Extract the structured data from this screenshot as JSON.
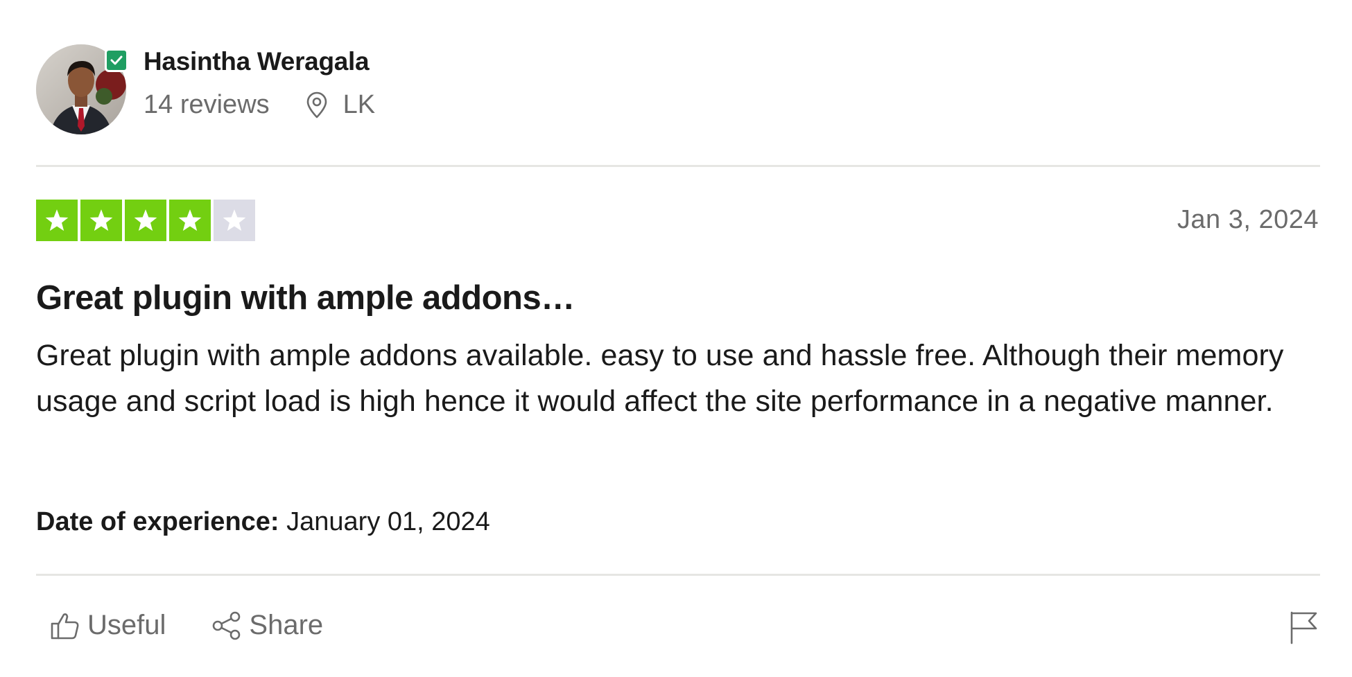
{
  "reviewer": {
    "name": "Hasintha Weragala",
    "reviews_count": "14 reviews",
    "country": "LK",
    "avatar_icon": "profile-photo",
    "verified_icon": "checkmark-icon"
  },
  "review": {
    "rating": 4,
    "rating_max": 5,
    "date": "Jan 3, 2024",
    "title": "Great plugin with ample addons…",
    "body": "Great plugin with ample addons available. easy to use and hassle free. Although their memory usage and script load is high hence it would affect the site performance in a negative manner.",
    "experience_label": "Date of experience:",
    "experience_date": " January 01, 2024"
  },
  "actions": {
    "useful_label": "Useful",
    "share_label": "Share",
    "flag_icon": "flag-icon"
  },
  "colors": {
    "star_on": "#73cf11",
    "star_off": "#dcdce6",
    "verified": "#1f9e62",
    "muted_text": "#6b6b6b"
  }
}
